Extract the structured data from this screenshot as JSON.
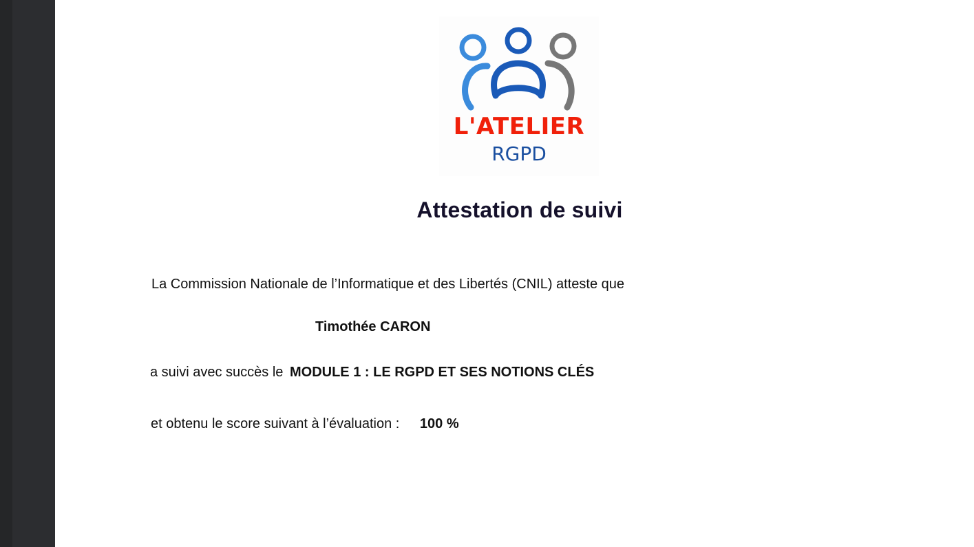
{
  "logo": {
    "text_main": "L'ATELIER",
    "text_sub": "RGPD",
    "colors": {
      "left_figure": "#3b8bdc",
      "center_figure": "#1a5ab8",
      "right_figure": "#777777",
      "wordmark_main": "#f0200a",
      "wordmark_sub": "#1a4fa0"
    }
  },
  "document": {
    "title": "Attestation de suivi",
    "intro": "La Commission Nationale de l’Informatique et des Libertés (CNIL) atteste que",
    "name": "Timothée CARON",
    "completion_prefix": "a suivi avec succès le",
    "module": "MODULE 1 : LE RGPD ET SES NOTIONS CLÉS",
    "score_prefix": "et obtenu le score suivant à l’évaluation :",
    "score": "100 %"
  }
}
